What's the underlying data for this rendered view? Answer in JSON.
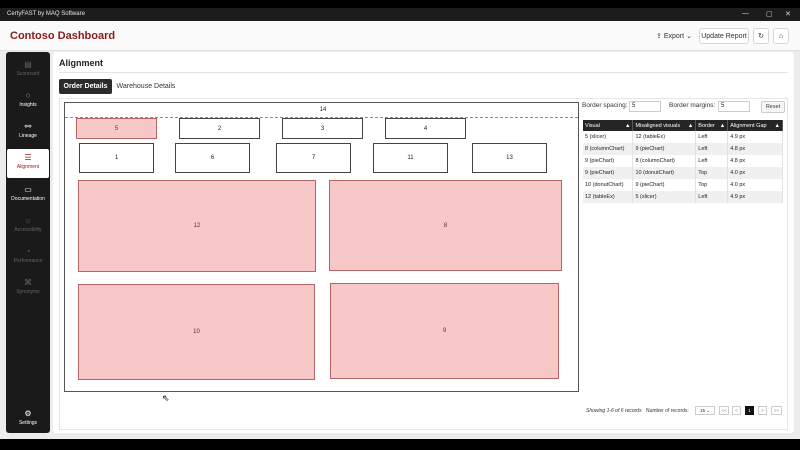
{
  "window_title": "CertyFAST by MAQ Software",
  "window_controls": {
    "minimize": "—",
    "maximize": "▢",
    "close": "✕"
  },
  "header": {
    "app_title": "Contoso Dashboard",
    "export_label": "Export",
    "update_label": "Update Report"
  },
  "sidebar": {
    "items": [
      {
        "label": "Scorecard",
        "icon": "scorecard-icon",
        "glyph": "▤"
      },
      {
        "label": "Insights",
        "icon": "bulb-icon",
        "glyph": "💡"
      },
      {
        "label": "Lineage",
        "icon": "lineage-icon",
        "glyph": "⚯"
      },
      {
        "label": "Alignment",
        "icon": "alignment-icon",
        "glyph": "☰"
      },
      {
        "label": "Documentation",
        "icon": "document-icon",
        "glyph": "▭"
      },
      {
        "label": "Accessibility",
        "icon": "accessibility-icon",
        "glyph": "☼"
      },
      {
        "label": "Performance",
        "icon": "gauge-icon",
        "glyph": "◔"
      },
      {
        "label": "Synonyms",
        "icon": "synonyms-icon",
        "glyph": "⌘"
      }
    ],
    "settings_label": "Settings"
  },
  "main": {
    "page_title": "Alignment",
    "tabs": [
      "Order Details",
      "Warehouse Details"
    ]
  },
  "canvas": {
    "visuals": [
      "14",
      "5",
      "2",
      "3",
      "4",
      "1",
      "6",
      "7",
      "11",
      "13",
      "12",
      "8",
      "10",
      "9"
    ]
  },
  "controls": {
    "border_spacing_label": "Border spacing:",
    "border_spacing_value": "5",
    "border_margins_label": "Border margins:",
    "border_margins_value": "5",
    "reset_label": "Reset"
  },
  "table": {
    "headers": [
      "Visual",
      "Misaligned visuals",
      "Border",
      "Alignment Gap"
    ],
    "rows": [
      [
        "5 (slicer)",
        "12 (tableEx)",
        "Left",
        "4.9 px"
      ],
      [
        "8 (columnChart)",
        "9 (pieChart)",
        "Left",
        "4.8 px"
      ],
      [
        "9 (pieChart)",
        "8 (columnChart)",
        "Left",
        "4.8 px"
      ],
      [
        "9 (pieChart)",
        "10 (donutChart)",
        "Top",
        "4.0 px"
      ],
      [
        "10 (donutChart)",
        "9 (pieChart)",
        "Top",
        "4.0 px"
      ],
      [
        "12 (tableEx)",
        "5 (slicer)",
        "Left",
        "4.9 px"
      ]
    ]
  },
  "pagination": {
    "summary": "Showing 1-6 of 6 records",
    "records_label": "Number of records:",
    "page_size": "15",
    "current_page": "1",
    "first": "<<",
    "prev": "<",
    "next": ">",
    "last": ">>"
  },
  "colors": {
    "accent": "#8b1a1a",
    "misaligned_fill": "#f8c8c8",
    "sidebar": "#1a1a1a"
  }
}
